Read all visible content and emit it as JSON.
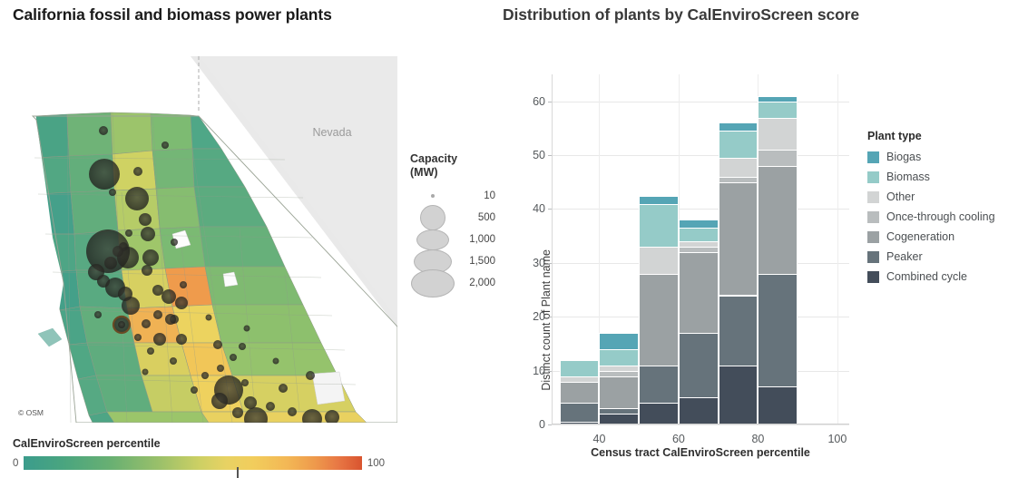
{
  "map_panel": {
    "title": "California fossil and biomass power plants",
    "osm_credit": "© OSM",
    "nevada_label": "Nevada",
    "capacity_legend": {
      "title_line1": "Capacity",
      "title_line2": "(MW)",
      "items": [
        {
          "label": "10",
          "diameter": 4
        },
        {
          "label": "500",
          "diameter": 26
        },
        {
          "label": "1,000",
          "diameter": 34
        },
        {
          "label": "1,500",
          "diameter": 40
        },
        {
          "label": "2,000",
          "diameter": 46
        }
      ]
    },
    "ces_legend": {
      "title": "CalEnviroScreen percentile",
      "min_label": "0",
      "max_label": "100",
      "colors": [
        "#3b9c8c",
        "#69b072",
        "#9ac06a",
        "#cdd064",
        "#f2cd5c",
        "#ee9a4c",
        "#d9542f"
      ]
    }
  },
  "chart_panel": {
    "title": "Distribution of plants by CalEnviroScreen score",
    "legend": {
      "title": "Plant type",
      "items": [
        {
          "label": "Biogas",
          "color": "#55a5b5"
        },
        {
          "label": "Biomass",
          "color": "#95cbc8"
        },
        {
          "label": "Other",
          "color": "#d2d4d4"
        },
        {
          "label": "Once-through cooling",
          "color": "#b9bdbe"
        },
        {
          "label": "Cogeneration",
          "color": "#9ba1a3"
        },
        {
          "label": "Peaker",
          "color": "#66737b"
        },
        {
          "label": "Combined cycle",
          "color": "#434d5a"
        }
      ]
    }
  },
  "chart_data": {
    "type": "bar",
    "stacked": true,
    "title": "Distribution of plants by CalEnviroScreen score",
    "xlabel": "Census tract CalEnviroScreen percentile",
    "ylabel": "Distinct count of Plant name",
    "xlim": [
      28,
      103
    ],
    "ylim": [
      0,
      65
    ],
    "x_ticks": [
      40,
      60,
      80,
      100
    ],
    "y_ticks": [
      0,
      10,
      20,
      30,
      40,
      50,
      60
    ],
    "grid": "horizontal-and-vertical",
    "legend_position": "right",
    "bin_width": 10,
    "bin_starts": [
      30,
      40,
      50,
      60,
      70,
      80
    ],
    "bin_centers": [
      35,
      45,
      55,
      65,
      75,
      85
    ],
    "categories": [
      "30-40",
      "40-50",
      "50-60",
      "60-70",
      "70-80",
      "80-90"
    ],
    "series": [
      {
        "name": "Combined cycle",
        "color": "#434d5a",
        "values": [
          0.5,
          2,
          4,
          5,
          11,
          7
        ]
      },
      {
        "name": "Peaker",
        "color": "#66737b",
        "values": [
          3.5,
          1,
          7,
          12,
          13,
          21
        ]
      },
      {
        "name": "Cogeneration",
        "color": "#9ba1a3",
        "values": [
          4,
          6,
          17,
          15,
          21,
          20
        ]
      },
      {
        "name": "Once-through cooling",
        "color": "#b9bdbe",
        "values": [
          0,
          1,
          0,
          1,
          1,
          3
        ]
      },
      {
        "name": "Other",
        "color": "#d2d4d4",
        "values": [
          1,
          1,
          5,
          1,
          3.5,
          6
        ]
      },
      {
        "name": "Biomass",
        "color": "#95cbc8",
        "values": [
          3,
          3,
          8,
          2.5,
          5,
          3
        ]
      },
      {
        "name": "Biogas",
        "color": "#55a5b5",
        "values": [
          0,
          3,
          1.5,
          1.5,
          1.5,
          1
        ]
      }
    ],
    "totals": [
      12,
      17,
      43,
      38,
      56,
      61
    ]
  }
}
